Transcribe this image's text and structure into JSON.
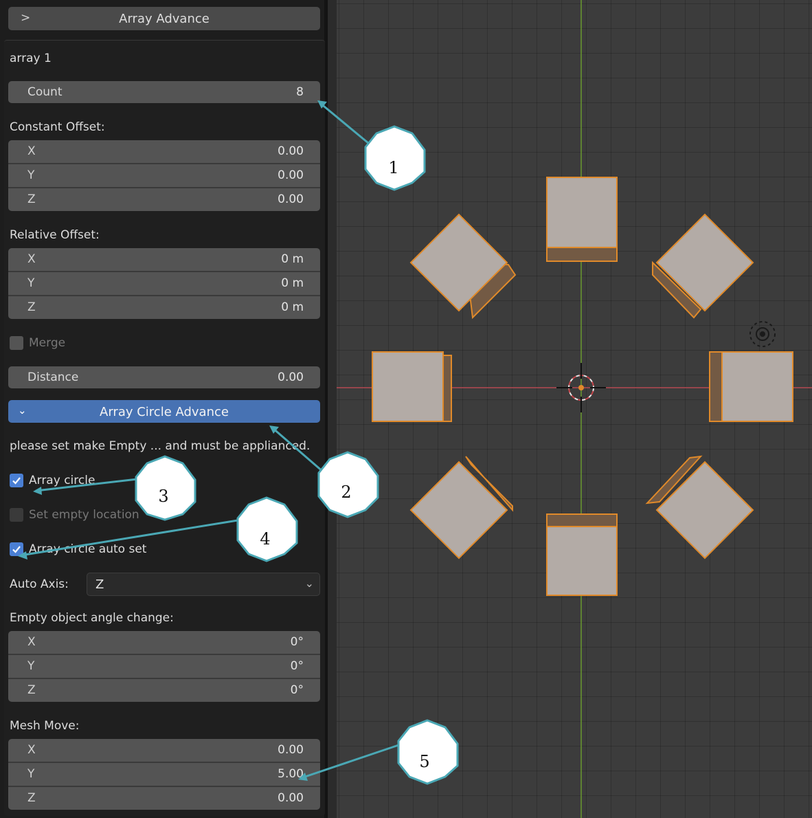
{
  "panel": {
    "header_title": "Array Advance",
    "section_title": "array 1",
    "count": {
      "label": "Count",
      "value": "8"
    },
    "constant_offset": {
      "label": "Constant Offset:",
      "rows": [
        {
          "axis": "X",
          "value": "0.00"
        },
        {
          "axis": "Y",
          "value": "0.00"
        },
        {
          "axis": "Z",
          "value": "0.00"
        }
      ]
    },
    "relative_offset": {
      "label": "Relative Offset:",
      "rows": [
        {
          "axis": "X",
          "value": "0 m"
        },
        {
          "axis": "Y",
          "value": "0 m"
        },
        {
          "axis": "Z",
          "value": "0 m"
        }
      ]
    },
    "merge": {
      "label": "Merge",
      "checked": false
    },
    "distance": {
      "label": "Distance",
      "value": "0.00"
    },
    "circle_header": "Array Circle Advance",
    "notice": "please set make Empty ... and must be applianced.",
    "array_circle": {
      "label": "Array circle",
      "checked": true
    },
    "set_empty_location": {
      "label": "Set empty location",
      "checked": false
    },
    "array_circle_auto_set": {
      "label": "Array circle auto set",
      "checked": true
    },
    "auto_axis": {
      "label": "Auto Axis:",
      "value": "Z"
    },
    "empty_angle": {
      "label": "Empty object angle change:",
      "rows": [
        {
          "axis": "X",
          "value": "0°"
        },
        {
          "axis": "Y",
          "value": "0°"
        },
        {
          "axis": "Z",
          "value": "0°"
        }
      ]
    },
    "mesh_move": {
      "label": "Mesh Move:",
      "rows": [
        {
          "axis": "X",
          "value": "0.00"
        },
        {
          "axis": "Y",
          "value": "5.00"
        },
        {
          "axis": "Z",
          "value": "0.00"
        }
      ]
    }
  },
  "callouts": [
    "1",
    "2",
    "3",
    "4",
    "5"
  ],
  "colors": {
    "accent": "#4772b3",
    "callout_stroke": "#4aa8b5",
    "selection": "#e08a2a",
    "x_axis": "#b54a52",
    "y_axis": "#6a9a2e"
  }
}
